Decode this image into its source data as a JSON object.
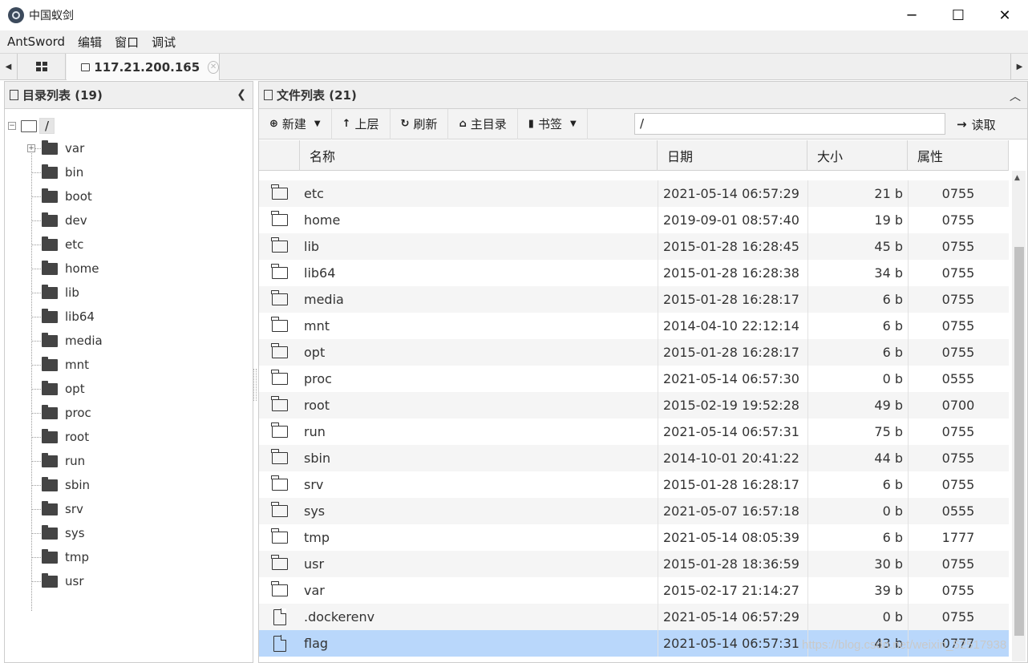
{
  "window": {
    "title": "中国蚁剑",
    "controls": [
      "─",
      "☐",
      "✕"
    ]
  },
  "menu": [
    "AntSword",
    "编辑",
    "窗口",
    "调试"
  ],
  "tabs": {
    "host": "117.21.200.165"
  },
  "left_panel": {
    "title": "目录列表 (19)",
    "root": "/",
    "items": [
      "var",
      "bin",
      "boot",
      "dev",
      "etc",
      "home",
      "lib",
      "lib64",
      "media",
      "mnt",
      "opt",
      "proc",
      "root",
      "run",
      "sbin",
      "srv",
      "sys",
      "tmp",
      "usr"
    ]
  },
  "right_panel": {
    "title": "文件列表 (21)",
    "toolbar": {
      "new": "新建",
      "up": "上层",
      "refresh": "刷新",
      "home": "主目录",
      "bookmark": "书签",
      "path": "/",
      "read": "读取"
    },
    "columns": {
      "name": "名称",
      "date": "日期",
      "size": "大小",
      "attr": "属性"
    },
    "rows": [
      {
        "type": "folder",
        "name": "etc",
        "date": "2021-05-14 06:57:29",
        "size": "21 b",
        "attr": "0755"
      },
      {
        "type": "folder",
        "name": "home",
        "date": "2019-09-01 08:57:40",
        "size": "19 b",
        "attr": "0755"
      },
      {
        "type": "folder",
        "name": "lib",
        "date": "2015-01-28 16:28:45",
        "size": "45 b",
        "attr": "0755"
      },
      {
        "type": "folder",
        "name": "lib64",
        "date": "2015-01-28 16:28:38",
        "size": "34 b",
        "attr": "0755"
      },
      {
        "type": "folder",
        "name": "media",
        "date": "2015-01-28 16:28:17",
        "size": "6 b",
        "attr": "0755"
      },
      {
        "type": "folder",
        "name": "mnt",
        "date": "2014-04-10 22:12:14",
        "size": "6 b",
        "attr": "0755"
      },
      {
        "type": "folder",
        "name": "opt",
        "date": "2015-01-28 16:28:17",
        "size": "6 b",
        "attr": "0755"
      },
      {
        "type": "folder",
        "name": "proc",
        "date": "2021-05-14 06:57:30",
        "size": "0 b",
        "attr": "0555"
      },
      {
        "type": "folder",
        "name": "root",
        "date": "2015-02-19 19:52:28",
        "size": "49 b",
        "attr": "0700"
      },
      {
        "type": "folder",
        "name": "run",
        "date": "2021-05-14 06:57:31",
        "size": "75 b",
        "attr": "0755"
      },
      {
        "type": "folder",
        "name": "sbin",
        "date": "2014-10-01 20:41:22",
        "size": "44 b",
        "attr": "0755"
      },
      {
        "type": "folder",
        "name": "srv",
        "date": "2015-01-28 16:28:17",
        "size": "6 b",
        "attr": "0755"
      },
      {
        "type": "folder",
        "name": "sys",
        "date": "2021-05-07 16:57:18",
        "size": "0 b",
        "attr": "0555"
      },
      {
        "type": "folder",
        "name": "tmp",
        "date": "2021-05-14 08:05:39",
        "size": "6 b",
        "attr": "1777"
      },
      {
        "type": "folder",
        "name": "usr",
        "date": "2015-01-28 18:36:59",
        "size": "30 b",
        "attr": "0755"
      },
      {
        "type": "folder",
        "name": "var",
        "date": "2015-02-17 21:14:27",
        "size": "39 b",
        "attr": "0755"
      },
      {
        "type": "file",
        "name": ".dockerenv",
        "date": "2021-05-14 06:57:29",
        "size": "0 b",
        "attr": "0755"
      },
      {
        "type": "file",
        "name": "flag",
        "date": "2021-05-14 06:57:31",
        "size": "43 b",
        "attr": "0777",
        "selected": true
      }
    ]
  },
  "watermark": "https://blog.csdn.net/weixin_52517938"
}
